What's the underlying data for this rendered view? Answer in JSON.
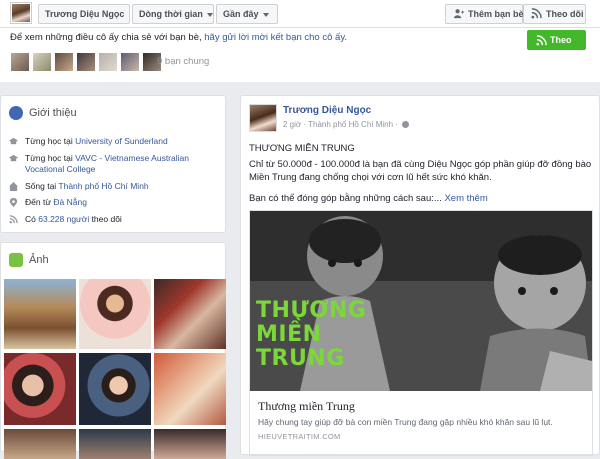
{
  "nav": {
    "profile_name": "Trương Diệu Ngọc",
    "timeline": "Dòng thời gian",
    "recent": "Gần đây",
    "add_friend": "Thêm bạn bè",
    "follow": "Theo dõi"
  },
  "suggest": {
    "text_before": "Để xem những điều cô ấy chia sẻ với bạn bè, ",
    "link": "hãy gửi lời mời kết bạn cho cô ấy.",
    "follow_button": "Theo dõi",
    "mutual_friends": "9 bạn chung"
  },
  "intro": {
    "title": "Giới thiệu",
    "rows": [
      {
        "prefix": "Từng học tại ",
        "link": "University of Sunderland",
        "suffix": ""
      },
      {
        "prefix": "Từng học tại ",
        "link": "VAVC - Vietnamese Australian Vocational College",
        "suffix": ""
      },
      {
        "prefix": "Sống tại ",
        "link": "Thành phố Hồ Chí Minh",
        "suffix": ""
      },
      {
        "prefix": "Đến từ ",
        "link": "Đà Nẵng",
        "suffix": ""
      },
      {
        "prefix": "Có ",
        "link": "63.228 người",
        "suffix": " theo dõi"
      }
    ]
  },
  "photos": {
    "title": "Ảnh"
  },
  "post": {
    "author": "Trương Diệu Ngọc",
    "time": "2 giờ",
    "location": "Thành phố Hồ Chí Minh",
    "heading": "THƯƠNG MIỀN TRUNG",
    "body": "Chỉ từ 50.000đ - 100.000đ là bạn đã cùng Diệu Ngọc góp phần giúp đỡ đồng bào Miền Trung đang chống chọi với cơn lũ hết sức khó khăn.",
    "more_text": "Bạn có thể đóng góp bằng những cách sau:...",
    "see_more": "Xem thêm",
    "preview": {
      "overlay_line1": "THƯƠNG",
      "overlay_line2": "MIỀN",
      "overlay_line3": "TRUNG",
      "title": "Thương miền Trung",
      "description": "Hãy chung tay giúp đỡ bà con miền Trung đang gặp nhiều khó khăn sau lũ lụt.",
      "domain": "HIEUVETRAITIM.COM"
    }
  },
  "colors": {
    "facebook_blue": "#365899",
    "follow_green": "#42b72a",
    "background": "#e9ebee",
    "overlay_green": "#7cd83a"
  }
}
